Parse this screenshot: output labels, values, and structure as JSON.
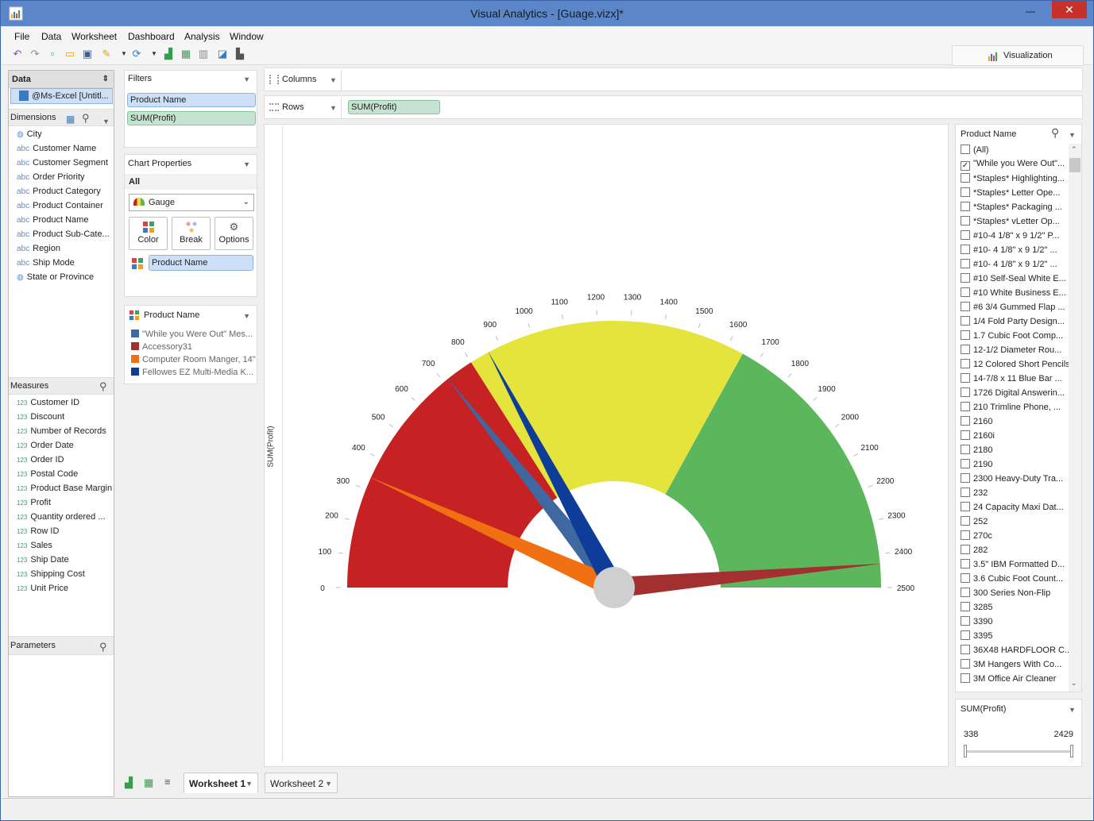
{
  "window": {
    "title": "Visual Analytics - [Guage.vizx]*",
    "close": "✕",
    "minimize": "—"
  },
  "menu": [
    "File",
    "Data",
    "Worksheet",
    "Dashboard",
    "Analysis",
    "Window"
  ],
  "toolbar": {
    "visualization_label": "Visualization"
  },
  "data_panel": {
    "title": "Data",
    "source": "@Ms-Excel [Untitl...",
    "dimensions_label": "Dimensions",
    "dimensions": [
      {
        "type": "geo",
        "name": "City"
      },
      {
        "type": "abc",
        "name": "Customer Name"
      },
      {
        "type": "abc",
        "name": "Customer Segment"
      },
      {
        "type": "abc",
        "name": "Order Priority"
      },
      {
        "type": "abc",
        "name": "Product Category"
      },
      {
        "type": "abc",
        "name": "Product Container"
      },
      {
        "type": "abc",
        "name": "Product Name"
      },
      {
        "type": "abc",
        "name": "Product Sub-Cate..."
      },
      {
        "type": "abc",
        "name": "Region"
      },
      {
        "type": "abc",
        "name": "Ship Mode"
      },
      {
        "type": "geo",
        "name": "State or Province"
      }
    ],
    "measures_label": "Measures",
    "measures": [
      {
        "type": "123",
        "name": "Customer ID"
      },
      {
        "type": "123",
        "name": "Discount"
      },
      {
        "type": "123",
        "name": "Number of Records"
      },
      {
        "type": "123",
        "name": "Order Date"
      },
      {
        "type": "123",
        "name": "Order ID"
      },
      {
        "type": "123",
        "name": "Postal Code"
      },
      {
        "type": "123",
        "name": "Product Base Margin"
      },
      {
        "type": "123",
        "name": "Profit"
      },
      {
        "type": "123",
        "name": "Quantity ordered ..."
      },
      {
        "type": "123",
        "name": "Row ID"
      },
      {
        "type": "123",
        "name": "Sales"
      },
      {
        "type": "123",
        "name": "Ship Date"
      },
      {
        "type": "123",
        "name": "Shipping Cost"
      },
      {
        "type": "123",
        "name": "Unit Price"
      }
    ],
    "parameters_label": "Parameters"
  },
  "filters": {
    "title": "Filters",
    "items": [
      "Product Name",
      "SUM(Profit)"
    ]
  },
  "chart_properties": {
    "title": "Chart Properties",
    "scope": "All",
    "chart_type": "Gauge",
    "buttons": [
      "Color",
      "Break",
      "Options"
    ],
    "color_field": "Product Name"
  },
  "legend": {
    "title": "Product Name",
    "items": [
      {
        "label": "\"While you Were Out\" Mes...",
        "color": "#3f68a0"
      },
      {
        "label": "Accessory31",
        "color": "#a23030"
      },
      {
        "label": "Computer Room Manger, 14\"",
        "color": "#f07012"
      },
      {
        "label": "Fellowes EZ Multi-Media K...",
        "color": "#0d3d99"
      }
    ]
  },
  "shelves": {
    "columns_label": "Columns",
    "rows_label": "Rows",
    "rows_pill": "SUM(Profit)"
  },
  "chart_data": {
    "type": "gauge",
    "ylabel": "SUM(Profit)",
    "range": [
      0,
      2500
    ],
    "ticks": [
      0,
      100,
      200,
      300,
      400,
      500,
      600,
      700,
      800,
      900,
      1000,
      1100,
      1200,
      1300,
      1400,
      1500,
      1600,
      1700,
      1800,
      1900,
      2000,
      2100,
      2200,
      2300,
      2400,
      2500
    ],
    "bands": [
      {
        "from": 0,
        "to": 800,
        "color": "#c62224"
      },
      {
        "from": 800,
        "to": 1650,
        "color": "#e4e43c"
      },
      {
        "from": 1650,
        "to": 2500,
        "color": "#5cb65c"
      }
    ],
    "needles": [
      {
        "name": "\"While you Were Out\" Mes...",
        "value": 715,
        "color": "#3f68a0"
      },
      {
        "name": "Accessory31",
        "value": 2429,
        "color": "#a23030"
      },
      {
        "name": "Computer Room Manger, 14\"",
        "value": 338,
        "color": "#f07012"
      },
      {
        "name": "Fellowes EZ Multi-Media K...",
        "value": 860,
        "color": "#0d3d99"
      }
    ]
  },
  "filter_list": {
    "title": "Product Name",
    "items": [
      {
        "label": "(All)",
        "checked": false
      },
      {
        "label": "\"While you Were Out\"...",
        "checked": true
      },
      {
        "label": "*Staples* Highlighting...",
        "checked": false
      },
      {
        "label": "*Staples* Letter Ope...",
        "checked": false
      },
      {
        "label": "*Staples* Packaging ...",
        "checked": false
      },
      {
        "label": "*Staples* vLetter Op...",
        "checked": false
      },
      {
        "label": "#10-4 1/8\" x 9 1/2\" P...",
        "checked": false
      },
      {
        "label": "#10- 4 1/8\" x 9 1/2\" ...",
        "checked": false
      },
      {
        "label": "#10- 4 1/8\" x 9 1/2\" ...",
        "checked": false
      },
      {
        "label": "#10 Self-Seal White E...",
        "checked": false
      },
      {
        "label": "#10 White Business E...",
        "checked": false
      },
      {
        "label": "#6 3/4 Gummed Flap ...",
        "checked": false
      },
      {
        "label": "1/4 Fold Party Design...",
        "checked": false
      },
      {
        "label": "1.7 Cubic Foot Comp...",
        "checked": false
      },
      {
        "label": "12-1/2 Diameter Rou...",
        "checked": false
      },
      {
        "label": "12 Colored Short Pencils",
        "checked": false
      },
      {
        "label": "14-7/8 x 11 Blue Bar ...",
        "checked": false
      },
      {
        "label": "1726 Digital Answerin...",
        "checked": false
      },
      {
        "label": "210 Trimline Phone, ...",
        "checked": false
      },
      {
        "label": "2160",
        "checked": false
      },
      {
        "label": "2160i",
        "checked": false
      },
      {
        "label": "2180",
        "checked": false
      },
      {
        "label": "2190",
        "checked": false
      },
      {
        "label": "2300 Heavy-Duty Tra...",
        "checked": false
      },
      {
        "label": "232",
        "checked": false
      },
      {
        "label": "24 Capacity Maxi Dat...",
        "checked": false
      },
      {
        "label": "252",
        "checked": false
      },
      {
        "label": "270c",
        "checked": false
      },
      {
        "label": "282",
        "checked": false
      },
      {
        "label": "3.5\" IBM Formatted D...",
        "checked": false
      },
      {
        "label": "3.6 Cubic Foot Count...",
        "checked": false
      },
      {
        "label": "300 Series Non-Flip",
        "checked": false
      },
      {
        "label": "3285",
        "checked": false
      },
      {
        "label": "3390",
        "checked": false
      },
      {
        "label": "3395",
        "checked": false
      },
      {
        "label": "36X48 HARDFLOOR C...",
        "checked": false
      },
      {
        "label": "3M Hangers With Co...",
        "checked": false
      },
      {
        "label": "3M Office Air Cleaner",
        "checked": false
      }
    ]
  },
  "range_filter": {
    "title": "SUM(Profit)",
    "min": "338",
    "max": "2429"
  },
  "tabs": [
    "Worksheet 1",
    "Worksheet 2"
  ]
}
